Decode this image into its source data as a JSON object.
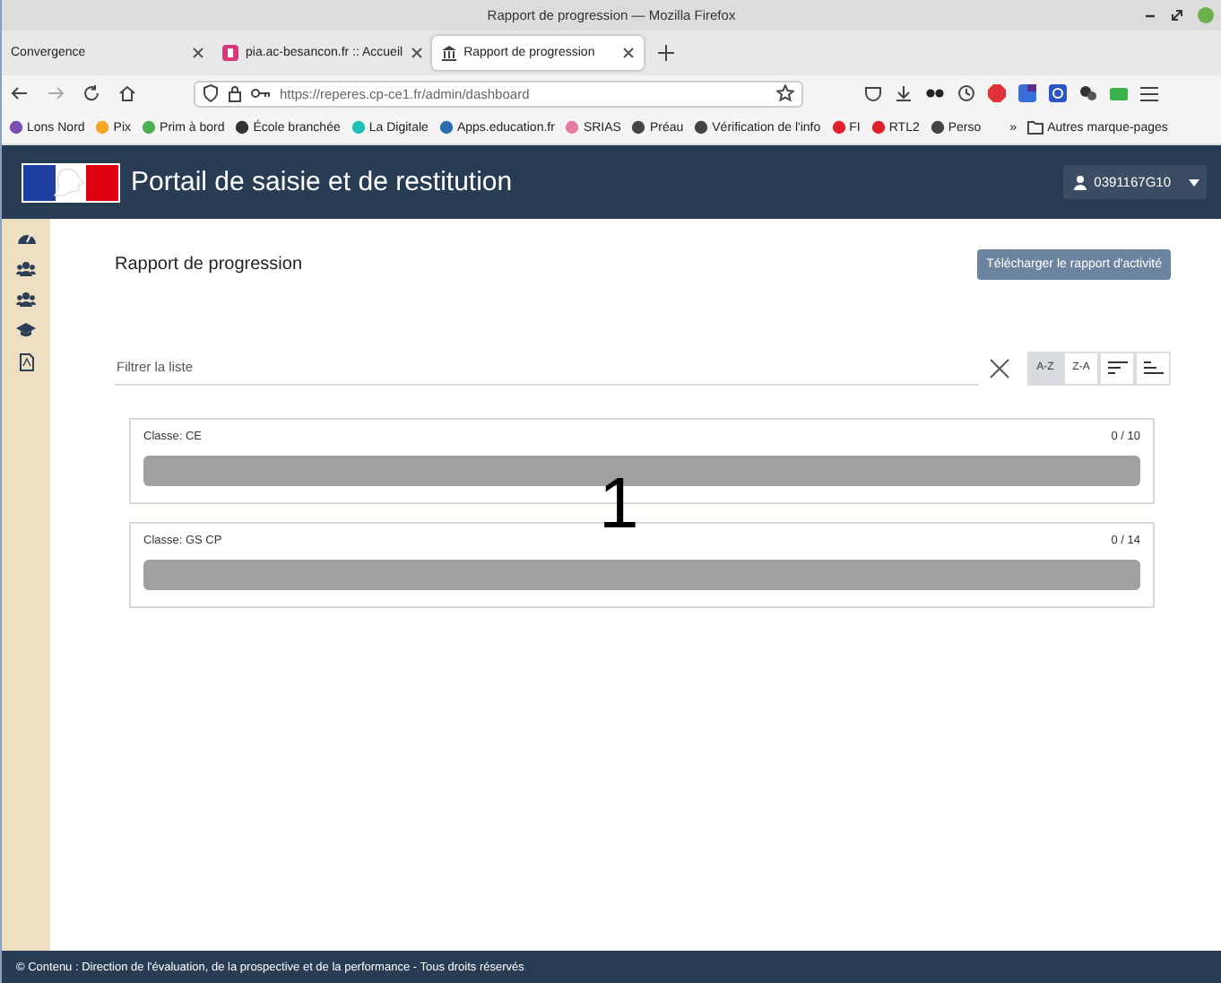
{
  "browser": {
    "window_title": "Rapport de progression — Mozilla Firefox",
    "tabs": [
      {
        "label": "Convergence",
        "selected": false,
        "icon": false
      },
      {
        "label": "pia.ac-besancon.fr :: Accueil",
        "selected": false,
        "icon": true
      },
      {
        "label": "Rapport de progression",
        "selected": true,
        "icon": true
      }
    ],
    "url": "https://reperes.cp-ce1.fr/admin/dashboard",
    "bookmarks": [
      {
        "label": "Lons Nord",
        "color": "#7a4fb0"
      },
      {
        "label": "Pix",
        "color": "#f5a623"
      },
      {
        "label": "Prim à bord",
        "color": "#4caf50"
      },
      {
        "label": "École branchée",
        "color": "#333333"
      },
      {
        "label": "La Digitale",
        "color": "#1bbfb5"
      },
      {
        "label": "Apps.education.fr",
        "color": "#2b6cb0"
      },
      {
        "label": "SRIAS",
        "color": "#e57aa5"
      },
      {
        "label": "Préau",
        "color": "#444444"
      },
      {
        "label": "Vérification de l'info",
        "color": "#444444"
      },
      {
        "label": "FI",
        "color": "#e0202a"
      },
      {
        "label": "RTL2",
        "color": "#e0202a"
      },
      {
        "label": "Perso",
        "color": "#444444"
      }
    ],
    "overflow": "»",
    "other_bookmarks": "Autres marque-pages"
  },
  "app": {
    "title": "Portail de saisie et de restitution",
    "user": "0391167G10"
  },
  "page": {
    "heading": "Rapport de progression",
    "download_button": "Télécharger le rapport d'activité",
    "filter": {
      "placeholder": "Filtrer la liste"
    },
    "sort_buttons": [
      {
        "label": "A-Z",
        "selected": true
      },
      {
        "label": "Z-A",
        "selected": false
      }
    ],
    "classes": [
      {
        "label": "Classe: CE",
        "count": "0 / 10"
      },
      {
        "label": "Classe: GS CP",
        "count": "0 / 14"
      }
    ]
  },
  "overlay_number": "1",
  "footer": "© Contenu : Direction de l'évaluation, de la prospective et de la performance - Tous droits réservés"
}
